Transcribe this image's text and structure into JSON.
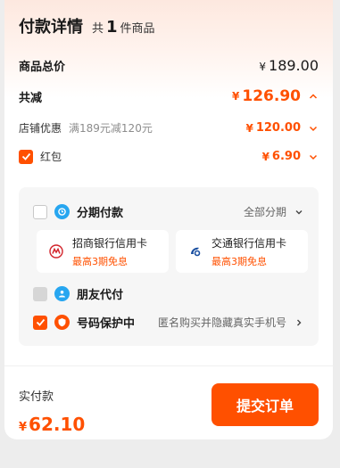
{
  "header": {
    "title": "付款详情",
    "count_prefix": "共",
    "count": "1",
    "count_suffix": "件商品"
  },
  "total": {
    "label": "商品总价",
    "currency": "¥",
    "amount": "189.00"
  },
  "discount": {
    "label": "共减",
    "currency": "¥",
    "amount": "126.90"
  },
  "shop_discount": {
    "label": "店铺优惠",
    "detail": "满189元减120元",
    "currency": "¥",
    "amount": "120.00"
  },
  "red_packet": {
    "label": "红包",
    "checked": true,
    "currency": "¥",
    "amount": "6.90"
  },
  "installment": {
    "label": "分期付款",
    "checked": false,
    "right_label": "全部分期",
    "banks": [
      {
        "name": "招商银行信用卡",
        "offer": "最高3期免息"
      },
      {
        "name": "交通银行信用卡",
        "offer": "最高3期免息"
      }
    ]
  },
  "friend_pay": {
    "label": "朋友代付",
    "disabled": true
  },
  "number_protect": {
    "label": "号码保护中",
    "checked": true,
    "right_label": "匿名购买并隐藏真实手机号"
  },
  "footer": {
    "pay_label": "实付款",
    "currency": "¥",
    "amount": "62.10",
    "submit_label": "提交订单"
  },
  "colors": {
    "accent": "#ff5000",
    "installment_icon": "#27a6f0",
    "friend_icon": "#27a6f0",
    "protect_icon": "#ff5000"
  }
}
